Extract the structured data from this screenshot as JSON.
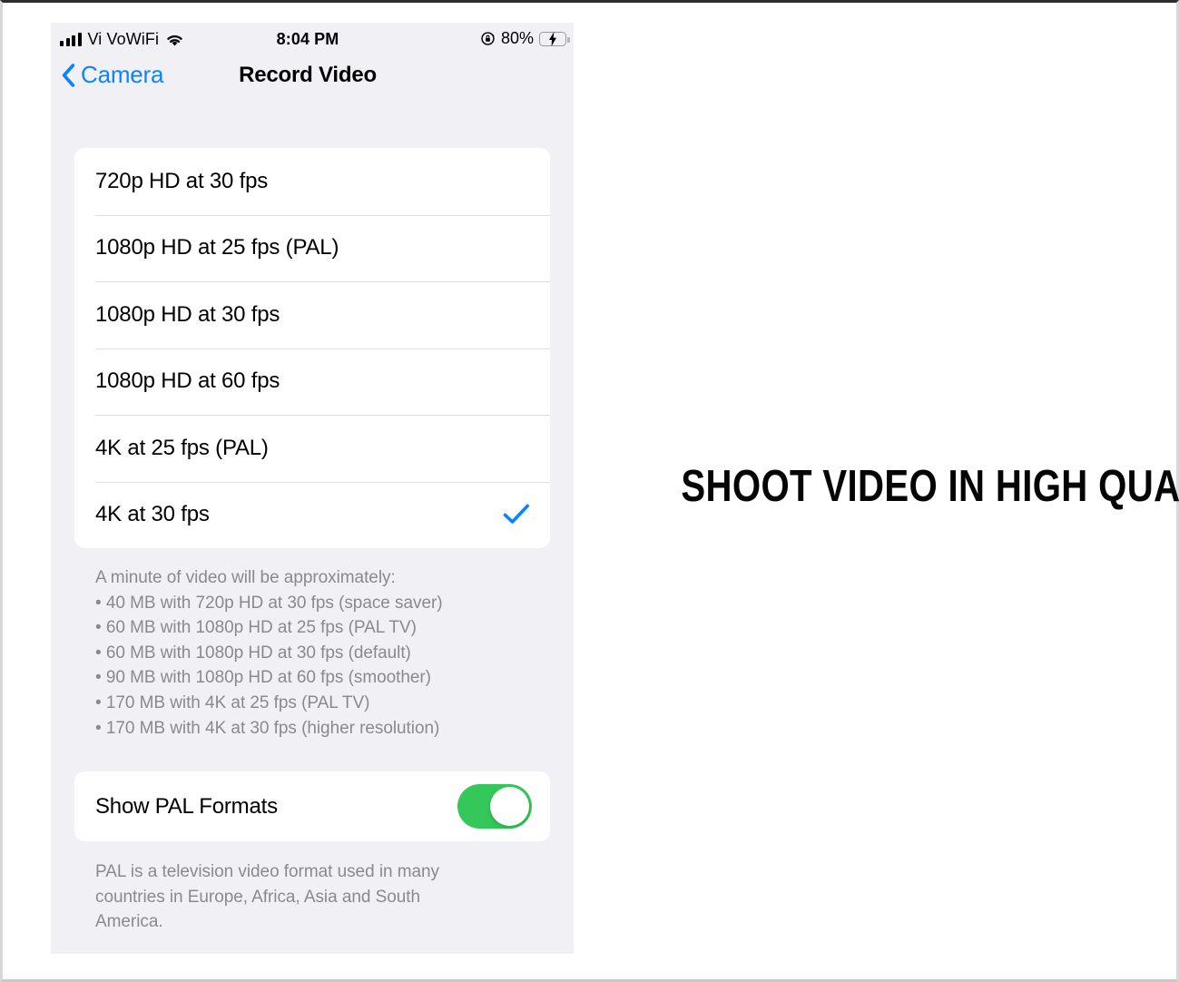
{
  "status_bar": {
    "carrier": "Vi VoWiFi",
    "signal_icon": "cellular-signal-icon",
    "wifi_icon": "wifi-icon",
    "time": "8:04 PM",
    "rotation_lock_icon": "rotation-lock-icon",
    "battery_percent": "80%",
    "battery_icon": "battery-charging-icon",
    "battery_color": "#2ecc50"
  },
  "nav": {
    "back_label": "Camera",
    "back_icon": "chevron-left-icon",
    "title": "Record Video",
    "accent_color": "#0a84ff"
  },
  "video_formats": {
    "options": [
      {
        "label": "720p HD at 30 fps",
        "selected": false
      },
      {
        "label": "1080p HD at 25 fps (PAL)",
        "selected": false
      },
      {
        "label": "1080p HD at 30 fps",
        "selected": false
      },
      {
        "label": "1080p HD at 60 fps",
        "selected": false
      },
      {
        "label": "4K at 25 fps (PAL)",
        "selected": false
      },
      {
        "label": "4K at 30 fps",
        "selected": true
      }
    ],
    "checkmark_icon": "checkmark-icon",
    "checkmark_color": "#0a84ff"
  },
  "size_footer": "A minute of video will be approximately:\n• 40 MB with 720p HD at 30 fps (space saver)\n• 60 MB with 1080p HD at 25 fps (PAL TV)\n• 60 MB with 1080p HD at 30 fps (default)\n• 90 MB with 1080p HD at 60 fps (smoother)\n• 170 MB with 4K at 25 fps (PAL TV)\n• 170 MB with 4K at 30 fps (higher resolution)",
  "pal_toggle": {
    "label": "Show PAL Formats",
    "value": "on",
    "on_color": "#34c759"
  },
  "pal_footer": "PAL is a television video format used in many countries in Europe, Africa, Asia and South America.",
  "caption": {
    "text": "SHOOT VIDEO IN HIGH QUALITY"
  }
}
